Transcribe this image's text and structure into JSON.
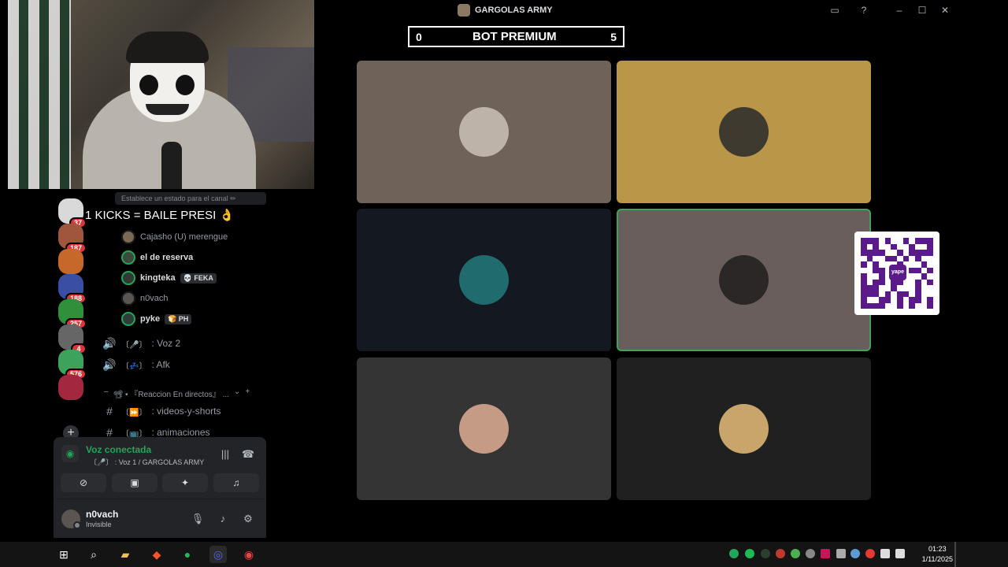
{
  "window": {
    "title": "GARGOLAS ARMY"
  },
  "scoreboard": {
    "left_score": "0",
    "title": "BOT PREMIUM",
    "right_score": "5"
  },
  "overlay_text": "1 KICKS = BAILE PRESI 👌",
  "servers": [
    {
      "badge": "37",
      "color": "#d9d9d9"
    },
    {
      "badge": "187",
      "color": "#a0563c"
    },
    {
      "badge": "",
      "color": "#c7682b"
    },
    {
      "badge": "188",
      "color": "#3a4fa3"
    },
    {
      "badge": "257",
      "color": "#2f8f3a"
    },
    {
      "badge": "4",
      "color": "#666666"
    },
    {
      "badge": "576",
      "color": "#3da35c"
    },
    {
      "badge": "",
      "color": "#a3283f"
    }
  ],
  "channel_list": {
    "status_hint": "Establece un estado para el canal ✏",
    "members": [
      {
        "name": "Cajasho (U) merengue",
        "tag": "",
        "dim": true
      },
      {
        "name": "el de reserva",
        "tag": "",
        "dim": false
      },
      {
        "name": "kingteka",
        "tag": "💀 FEKA",
        "dim": false
      },
      {
        "name": "n0vach",
        "tag": "",
        "dim": true
      },
      {
        "name": "pyke",
        "tag": "🍞 PH",
        "dim": false
      }
    ],
    "channels": [
      {
        "icon": "🔊",
        "emoji": "〔🎤〕",
        "name": ": Voz 2"
      },
      {
        "icon": "🔊",
        "emoji": "〔💤〕",
        "name": ": Afk"
      }
    ],
    "category": "📽 • 『Reaccion En directos』 ...",
    "text_channels": [
      {
        "icon": "#",
        "emoji": "〔⏩〕",
        "name": ": videos-y-shorts"
      },
      {
        "icon": "#",
        "emoji": "〔📺〕",
        "name": ": animaciones"
      }
    ]
  },
  "voice_panel": {
    "title": "Voz conectada",
    "subtitle": "〔🎤〕 : Voz 1 / GARGOLAS ARMY"
  },
  "user_panel": {
    "name": "n0vach",
    "status": "Invisible"
  },
  "tiles": [
    {
      "bg": "#6f6259",
      "pfp": "#bdb3a8",
      "speaking": false
    },
    {
      "bg": "#b99648",
      "pfp": "#3e3a30",
      "speaking": false
    },
    {
      "bg": "#141820",
      "pfp": "#1f6b6e",
      "speaking": false
    },
    {
      "bg": "#6a5e5c",
      "pfp": "#2a2726",
      "speaking": true
    },
    {
      "bg": "#343434",
      "pfp": "#c69b85",
      "speaking": false
    },
    {
      "bg": "#202020",
      "pfp": "#c8a56b",
      "speaking": false
    }
  ],
  "qr": {
    "logo": "yape"
  },
  "clock": {
    "time": "01:23",
    "date": "1/11/2025"
  }
}
